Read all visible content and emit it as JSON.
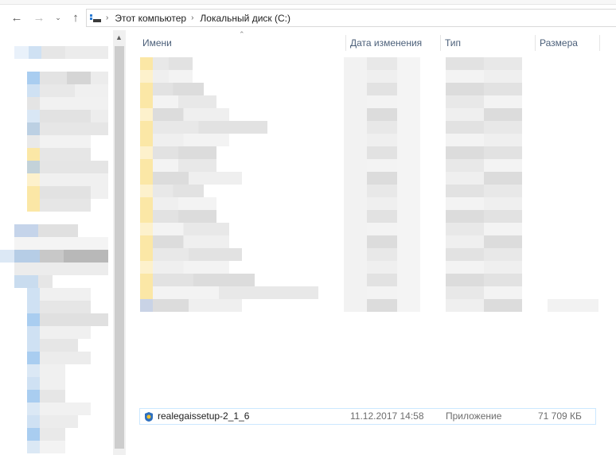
{
  "address": {
    "crumbs": [
      "Этот компьютер",
      "Локальный диск (C:)"
    ]
  },
  "columns": {
    "name": "Имени",
    "date": "Дата изменения",
    "type": "Тип",
    "size": "Размера"
  },
  "selected_file": {
    "name": "realegaissetup-2_1_6",
    "date": "11.12.2017 14:58",
    "type": "Приложение",
    "size": "71 709 КБ"
  },
  "icons": {
    "back": "arrow-left-icon",
    "forward": "arrow-right-icon",
    "recent": "chevron-down-icon",
    "up": "arrow-up-icon",
    "location": "computer-icon",
    "file": "installer-app-icon"
  },
  "colors": {
    "folder": "#fbe7a6",
    "selection_border": "#cce8ff",
    "header_text": "#4c607a"
  }
}
